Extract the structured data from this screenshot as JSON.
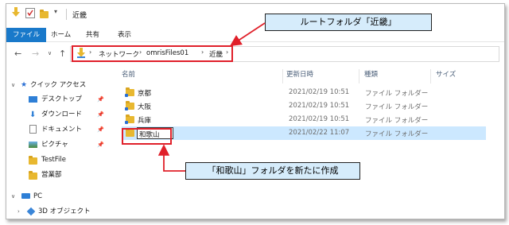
{
  "window": {
    "title": "近畿",
    "quick_access_down_arrow": "▾"
  },
  "ribbon": {
    "tabs": [
      {
        "label": "ファイル",
        "active": true
      },
      {
        "label": "ホーム"
      },
      {
        "label": "共有"
      },
      {
        "label": "表示"
      }
    ]
  },
  "address_bar": {
    "breadcrumbs": [
      "ネットワーク",
      "omrisFiles01",
      "近畿"
    ]
  },
  "columns": {
    "name": "名前",
    "date": "更新日時",
    "type": "種類",
    "size": "サイズ"
  },
  "nav_pane": {
    "quick_access": "クイック アクセス",
    "items": [
      {
        "label": "デスクトップ",
        "icon": "desktop-icon",
        "pinned": true
      },
      {
        "label": "ダウンロード",
        "icon": "download-icon",
        "pinned": true
      },
      {
        "label": "ドキュメント",
        "icon": "document-icon",
        "pinned": true
      },
      {
        "label": "ピクチャ",
        "icon": "picture-icon",
        "pinned": true
      },
      {
        "label": "TestFile",
        "icon": "folder-icon"
      },
      {
        "label": "営業部",
        "icon": "folder-icon"
      }
    ],
    "pc": "PC",
    "objects3d": "3D オブジェクト"
  },
  "files": [
    {
      "name": "京都",
      "date": "2021/02/19 10:51",
      "type": "ファイル フォルダー"
    },
    {
      "name": "大阪",
      "date": "2021/02/19 10:51",
      "type": "ファイル フォルダー"
    },
    {
      "name": "兵庫",
      "date": "2021/02/19 10:51",
      "type": "ファイル フォルダー"
    },
    {
      "name": "和歌山",
      "date": "2021/02/22 11:07",
      "type": "ファイル フォルダー",
      "selected": true,
      "renaming": true
    }
  ],
  "callouts": {
    "top": "ルートフォルダ「近畿」",
    "bottom": "「和歌山」フォルダを新たに作成"
  },
  "colors": {
    "accent": "#1979ca",
    "highlight": "#e0202a",
    "selection": "#cce8ff",
    "callout_bg": "#d6ecfb"
  }
}
